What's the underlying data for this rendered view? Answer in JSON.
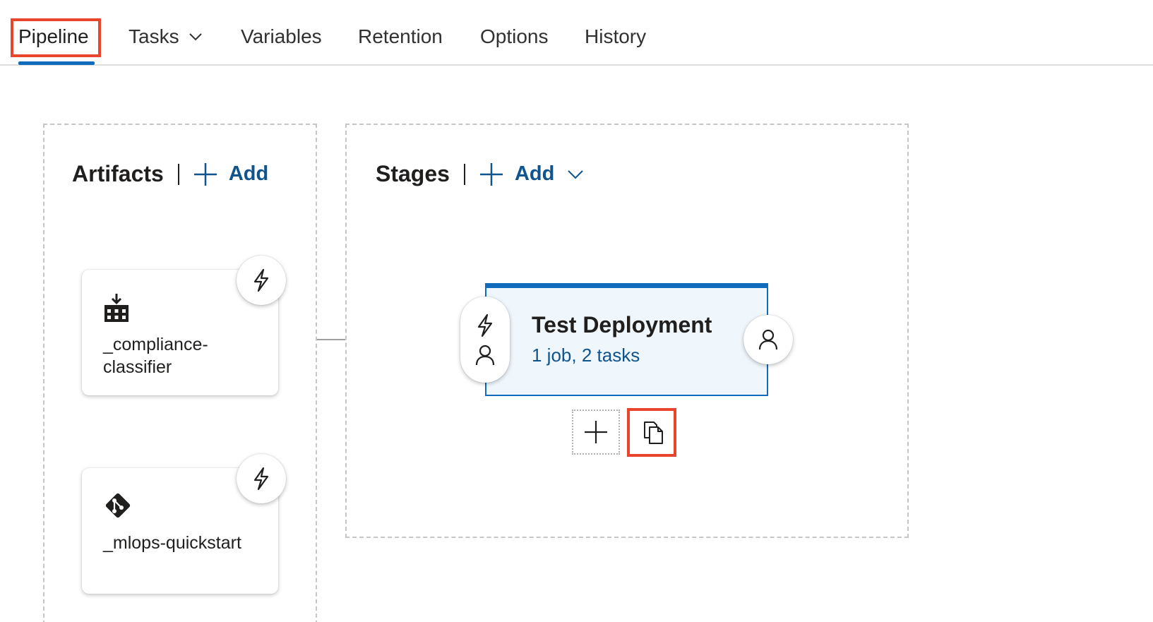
{
  "tabs": [
    {
      "label": "Pipeline",
      "active": true
    },
    {
      "label": "Tasks",
      "has_dropdown": true
    },
    {
      "label": "Variables"
    },
    {
      "label": "Retention"
    },
    {
      "label": "Options"
    },
    {
      "label": "History"
    }
  ],
  "artifacts": {
    "title": "Artifacts",
    "add_label": "Add",
    "items": [
      {
        "name": "_compliance-classifier",
        "icon": "build-artifact-icon"
      },
      {
        "name": "_mlops-quickstart",
        "icon": "git-repo-icon"
      }
    ]
  },
  "stages": {
    "title": "Stages",
    "add_label": "Add",
    "items": [
      {
        "name": "Test Deployment",
        "summary": "1 job, 2 tasks"
      }
    ]
  },
  "colors": {
    "accent": "#0f6cbd",
    "link": "#0f548c",
    "highlight": "#e8452c",
    "stage_fill": "#eff6fc"
  }
}
